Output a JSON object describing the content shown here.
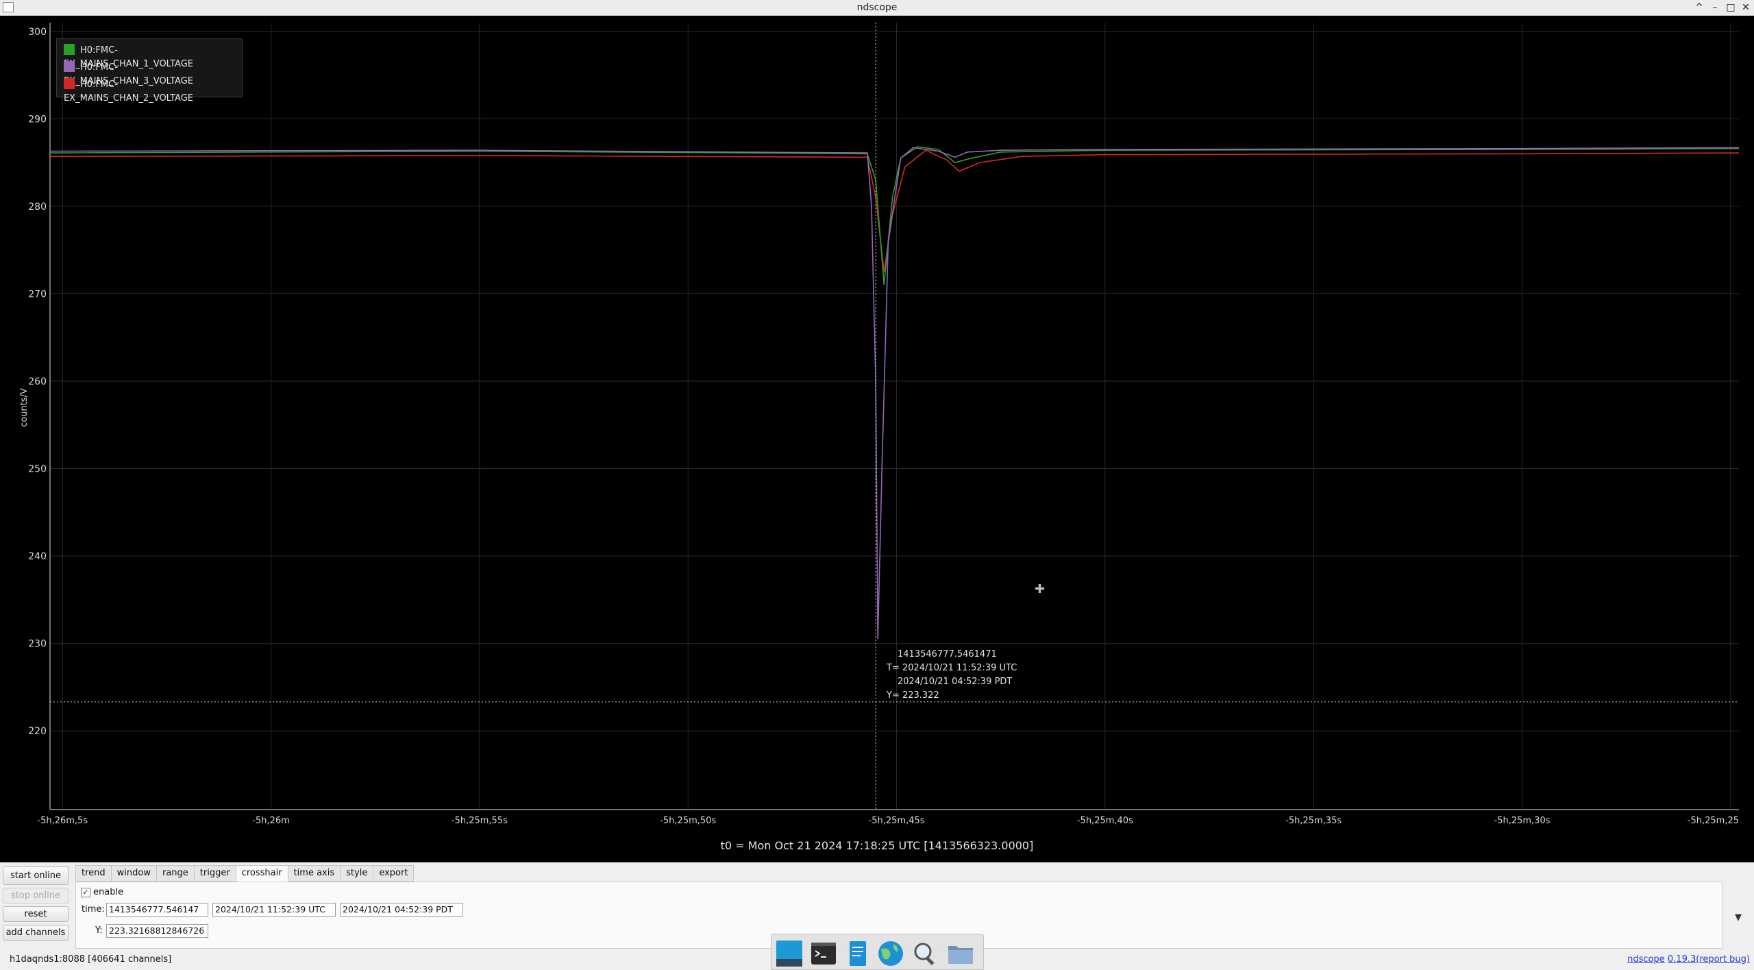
{
  "window": {
    "title": "ndscope",
    "controls": [
      "^",
      "–",
      "□",
      "✕"
    ]
  },
  "plot": {
    "ylabel": "counts/V",
    "yticks": [
      "300",
      "290",
      "280",
      "270",
      "260",
      "250",
      "240",
      "230",
      "220"
    ],
    "xticks": [
      "-5h,26m,5s",
      "-5h,26m",
      "-5h,25m,55s",
      "-5h,25m,50s",
      "-5h,25m,45s",
      "-5h,25m,40s",
      "-5h,25m,35s",
      "-5h,25m,30s",
      "-5h,25m,25"
    ],
    "legend": [
      {
        "name": "H0:FMC-EX_MAINS_CHAN_1_VOLTAGE",
        "color": "#2ca02c"
      },
      {
        "name": "H0:FMC-EX_MAINS_CHAN_3_VOLTAGE",
        "color": "#9467bd"
      },
      {
        "name": "H0:FMC-EX_MAINS_CHAN_2_VOLTAGE",
        "color": "#d62728"
      }
    ],
    "t0_label": "t0 = Mon Oct 21 2024 17:18:25 UTC [1413566323.0000]",
    "crosshair": {
      "gps": "1413546777.5461471",
      "utc": "T= 2024/10/21 11:52:39 UTC",
      "pdt": "2024/10/21 04:52:39 PDT",
      "y": "Y= 223.322"
    }
  },
  "chart_data": {
    "type": "line",
    "ylabel": "counts/V",
    "ylim": [
      211,
      301
    ],
    "x_unit": "seconds relative to t0 (-5h offset)",
    "xticks": [
      "-5h,26m,5s",
      "-5h,26m",
      "-5h,25m,55s",
      "-5h,25m,50s",
      "-5h,25m,45s",
      "-5h,25m,40s",
      "-5h,25m,35s",
      "-5h,25m,30s",
      "-5h,25m,25"
    ],
    "xlim": [
      -19565.3,
      -19524.8
    ],
    "grid": true,
    "legend_position": "top-left",
    "series": [
      {
        "name": "H0:FMC-EX_MAINS_CHAN_1_VOLTAGE",
        "color": "#2ca02c",
        "x": [
          -19565.3,
          -19555,
          -19545.7,
          -19545.5,
          -19545.3,
          -19545.2,
          -19545.1,
          -19544.9,
          -19544.5,
          -19544.0,
          -19543.6,
          -19543.2,
          -19542.5,
          -19540,
          -19530,
          -19524.8
        ],
        "y": [
          286.1,
          286.3,
          286.0,
          283,
          271,
          276,
          281,
          285.5,
          286.8,
          286.5,
          285.0,
          285.5,
          286.2,
          286.4,
          286.5,
          286.6
        ]
      },
      {
        "name": "H0:FMC-EX_MAINS_CHAN_3_VOLTAGE",
        "color": "#9467bd",
        "x": [
          -19565.3,
          -19555,
          -19545.7,
          -19545.6,
          -19545.5,
          -19545.45,
          -19545.35,
          -19545.2,
          -19544.9,
          -19544.6,
          -19544.0,
          -19543.6,
          -19543.3,
          -19542.5,
          -19540,
          -19530,
          -19524.8
        ],
        "y": [
          286.3,
          286.4,
          286.1,
          280,
          260,
          230.5,
          250,
          276,
          285.5,
          286.7,
          286.3,
          285.6,
          286.2,
          286.4,
          286.5,
          286.6,
          286.7
        ]
      },
      {
        "name": "H0:FMC-EX_MAINS_CHAN_2_VOLTAGE",
        "color": "#d62728",
        "x": [
          -19565.3,
          -19555,
          -19545.7,
          -19545.5,
          -19545.3,
          -19545.1,
          -19544.8,
          -19544.3,
          -19543.8,
          -19543.5,
          -19543.0,
          -19542.0,
          -19540,
          -19530,
          -19524.8
        ],
        "y": [
          285.7,
          285.8,
          285.6,
          281,
          272.5,
          279,
          284.5,
          286.4,
          285.3,
          284.0,
          285.0,
          285.7,
          285.9,
          286.0,
          286.1
        ]
      }
    ]
  },
  "controls": {
    "side_buttons": [
      "start online",
      "stop online",
      "reset",
      "add channels"
    ],
    "tabs": [
      "trend",
      "window",
      "range",
      "trigger",
      "crosshair",
      "time axis",
      "style",
      "export"
    ],
    "active_tab": "crosshair",
    "enable_label": "enable",
    "enable_checked": "✓",
    "time_label": "time:",
    "time_gps": "1413546777.546147",
    "time_utc": "2024/10/21 11:52:39 UTC",
    "time_pdt": "2024/10/21 04:52:39 PDT",
    "y_label": "Y:",
    "y_value": "223.32168812846726",
    "collapse_icon": "▼"
  },
  "status": {
    "server": "h1daqnds1:8088",
    "channels": "[406641 channels]",
    "app_link": "ndscope",
    "version": "0.19.3",
    "report": "(report bug)"
  },
  "dock": {
    "icons": [
      "show-desktop-icon",
      "terminal-icon",
      "text-editor-icon",
      "browser-icon",
      "search-icon",
      "file-manager-icon"
    ]
  }
}
